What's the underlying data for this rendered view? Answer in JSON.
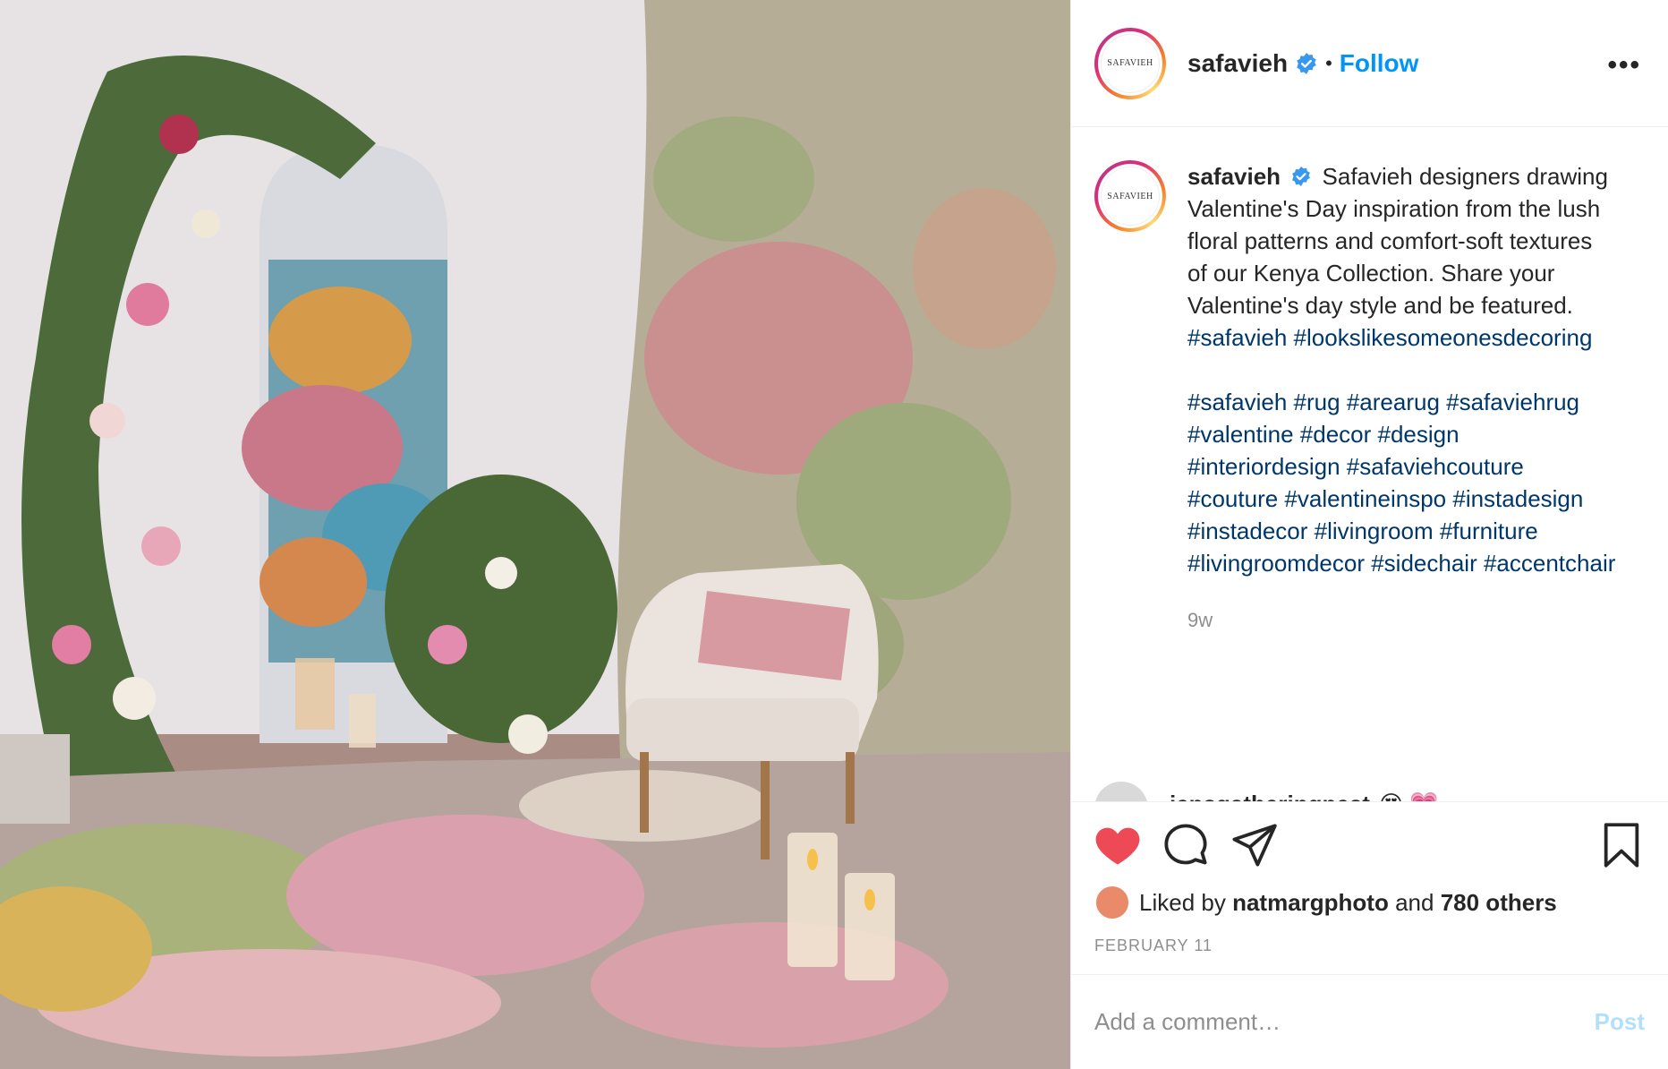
{
  "photo": {
    "description_icon": "photo-image"
  },
  "header": {
    "avatar_text": "SAFAVIEH",
    "username": "safavieh",
    "separator": "•",
    "follow_label": "Follow",
    "more_icon": "more-horizontal-icon",
    "more_label": "•••"
  },
  "caption": {
    "avatar_text": "SAFAVIEH",
    "username": "safavieh",
    "text": "Safavieh designers drawing Valentine's Day inspiration from the lush floral patterns and comfort-soft textures of our Kenya Collection. Share your Valentine's day style and be featured.",
    "inline_tags": [
      "#safavieh",
      "#lookslikesomeonesdecoring"
    ],
    "tags": [
      "#safavieh",
      "#rug",
      "#arearug",
      "#safaviehrug",
      "#valentine",
      "#decor",
      "#design",
      "#interiordesign",
      "#safaviehcouture",
      "#couture",
      "#valentineinspo",
      "#instadesign",
      "#instadecor",
      "#livingroom",
      "#furniture",
      "#livingroomdecor",
      "#sidechair",
      "#accentchair"
    ],
    "time": "9w"
  },
  "next_comment": {
    "username": "jensgatheringnest",
    "text": "😍 💗"
  },
  "actions": {
    "like_icon": "heart-filled-icon",
    "comment_icon": "comment-icon",
    "share_icon": "share-icon",
    "save_icon": "bookmark-icon",
    "like_color": "#ed4956"
  },
  "likes": {
    "prefix": "Liked by",
    "user": "natmargphoto",
    "middle": "and",
    "count": "780 others"
  },
  "date": "FEBRUARY 11",
  "comment_box": {
    "placeholder": "Add a comment…",
    "post_label": "Post"
  },
  "colors": {
    "accent": "#0095f6",
    "hashtag": "#00376b",
    "muted": "#8e8e8e",
    "post_disabled": "#b2dffc"
  }
}
